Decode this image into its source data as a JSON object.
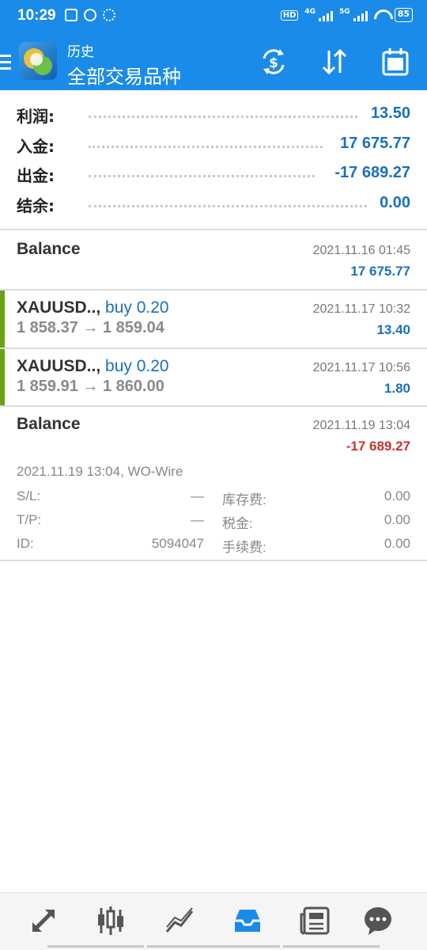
{
  "status_bar": {
    "time": "10:29",
    "hd": "HD",
    "net1": "4G",
    "net2": "5G",
    "battery": "85"
  },
  "header": {
    "subtitle": "历史",
    "title": "全部交易品种"
  },
  "summary": [
    {
      "label": "利润:",
      "value": "13.50"
    },
    {
      "label": "入金:",
      "value": "17 675.77"
    },
    {
      "label": "出金:",
      "value": "-17 689.27"
    },
    {
      "label": "结余:",
      "value": "0.00"
    }
  ],
  "deals": [
    {
      "title": "Balance",
      "time": "2021.11.16 01:45",
      "profit": "17 675.77"
    },
    {
      "symbol": "XAUUSD..,",
      "action": "buy 0.20",
      "prices": "1 858.37 → 1 859.04",
      "time": "2021.11.17 10:32",
      "profit": "13.40"
    },
    {
      "symbol": "XAUUSD..,",
      "action": "buy 0.20",
      "prices": "1 859.91 → 1 860.00",
      "time": "2021.11.17 10:56",
      "profit": "1.80"
    },
    {
      "title": "Balance",
      "time": "2021.11.19 13:04",
      "profit": "-17 689.27"
    }
  ],
  "details": {
    "line": "2021.11.19 13:04, WO-Wire",
    "sl_label": "S/L:",
    "sl_value": "—",
    "tp_label": "T/P:",
    "tp_value": "—",
    "id_label": "ID:",
    "id_value": "5094047",
    "swap_label": "库存费:",
    "swap_value": "0.00",
    "tax_label": "税金:",
    "tax_value": "0.00",
    "fee_label": "手续费:",
    "fee_value": "0.00"
  },
  "colors": {
    "brand_blue": "#1a8be8",
    "profit_blue": "#1a6fc0",
    "loss_red": "#c8322e",
    "accent_green": "#6aa316"
  },
  "bottom_nav": [
    "trade-arrows-icon",
    "candlestick-icon",
    "chart-lines-icon",
    "history-inbox-icon",
    "news-icon",
    "chat-icon"
  ]
}
